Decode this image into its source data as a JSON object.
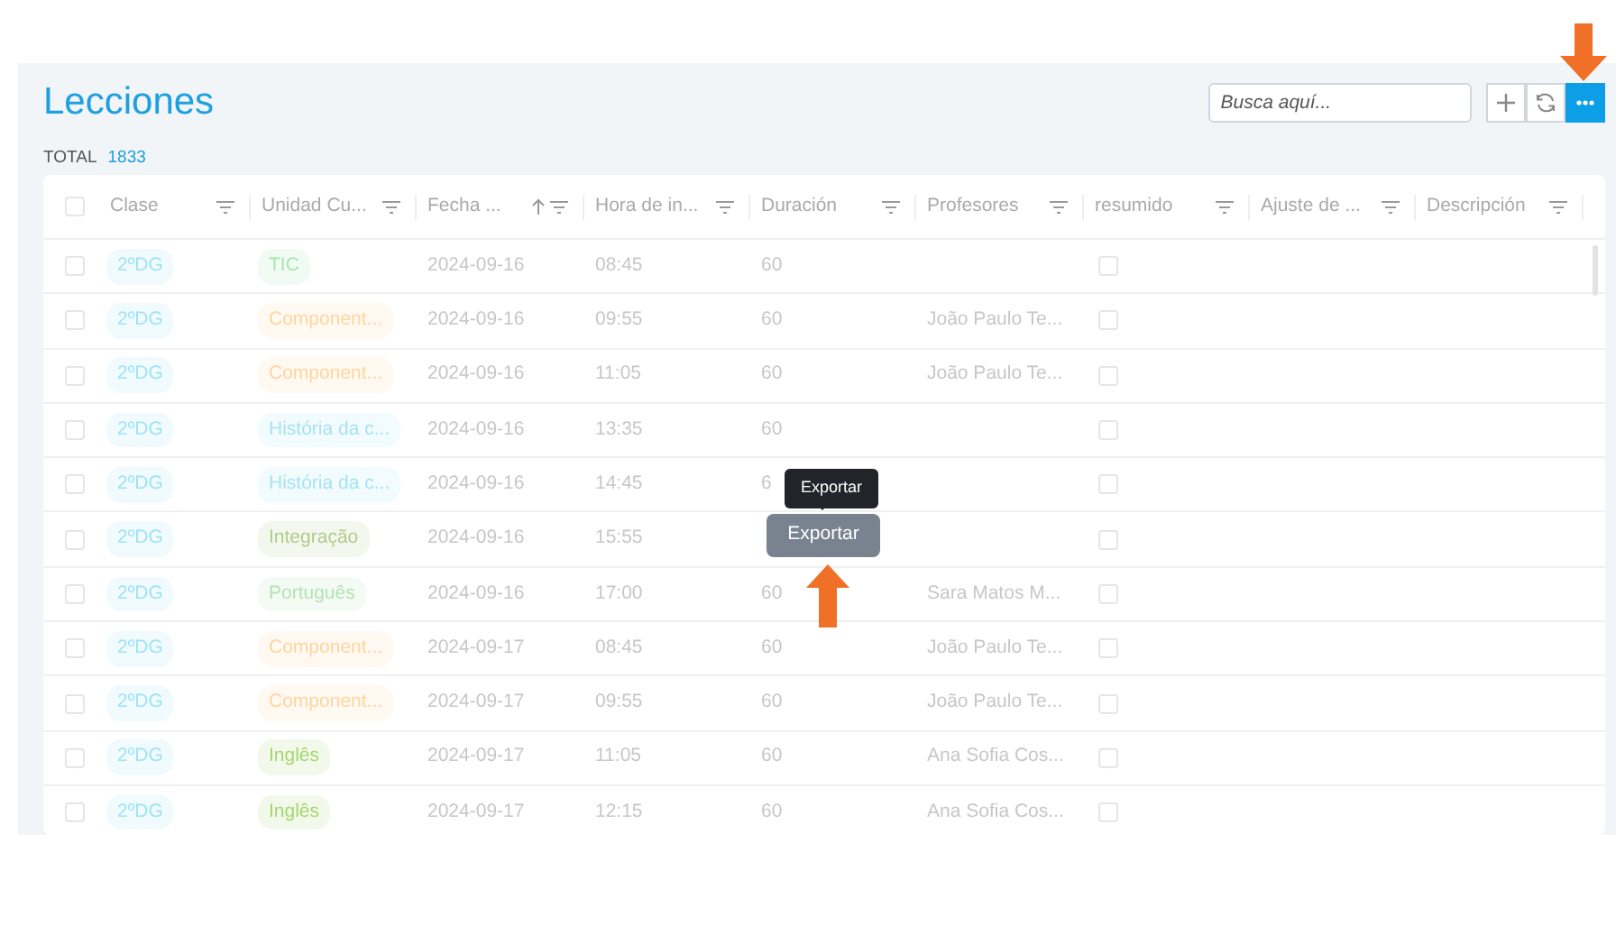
{
  "page": {
    "title": "Lecciones",
    "total_label": "TOTAL",
    "total_value": "1833"
  },
  "search": {
    "placeholder": "Busca aquí..."
  },
  "select_all": {
    "checked": false
  },
  "toolbar_buttons": [
    {
      "kind": "add"
    },
    {
      "kind": "refresh"
    },
    {
      "kind": "more",
      "selected": true
    }
  ],
  "table": {
    "columns": [
      {
        "label": "Clase",
        "sorted": false
      },
      {
        "label": "Unidad Cu...",
        "sorted": false
      },
      {
        "label": "Fecha ...",
        "sorted": true
      },
      {
        "label": "Hora de in...",
        "sorted": false
      },
      {
        "label": "Duración",
        "sorted": false
      },
      {
        "label": "Profesores",
        "sorted": false
      },
      {
        "label": "resumido",
        "sorted": false
      },
      {
        "label": "Ajuste de ...",
        "sorted": false
      },
      {
        "label": "Descripción",
        "sorted": false
      }
    ],
    "rows": [
      {
        "selected": false,
        "class": {
          "text": "2ºDG",
          "color": "#9fe3f5"
        },
        "unit": {
          "text": "TIC",
          "color": "#a6e6b0"
        },
        "date": "2024-09-16",
        "start": "08:45",
        "duration": "60",
        "summarized": false
      },
      {
        "selected": false,
        "class": {
          "text": "2ºDG",
          "color": "#9fe3f5"
        },
        "unit": {
          "text": "Component...",
          "color": "#ffd59e"
        },
        "date": "2024-09-16",
        "start": "09:55",
        "duration": "60",
        "teachers": "João Paulo Te...",
        "summarized": false
      },
      {
        "selected": false,
        "class": {
          "text": "2ºDG",
          "color": "#9fe3f5"
        },
        "unit": {
          "text": "Component...",
          "color": "#ffd59e"
        },
        "date": "2024-09-16",
        "start": "11:05",
        "duration": "60",
        "teachers": "João Paulo Te...",
        "summarized": false
      },
      {
        "selected": false,
        "class": {
          "text": "2ºDG",
          "color": "#9fe3f5"
        },
        "unit": {
          "text": "História da c...",
          "color": "#a6e3f3"
        },
        "date": "2024-09-16",
        "start": "13:35",
        "duration": "60",
        "summarized": false
      },
      {
        "selected": false,
        "class": {
          "text": "2ºDG",
          "color": "#9fe3f5"
        },
        "unit": {
          "text": "História da c...",
          "color": "#a6e3f3"
        },
        "date": "2024-09-16",
        "start": "14:45",
        "duration": "6",
        "summarized": false
      },
      {
        "selected": false,
        "class": {
          "text": "2ºDG",
          "color": "#9fe3f5"
        },
        "unit": {
          "text": "Integração",
          "color": "#b2cc8a"
        },
        "date": "2024-09-16",
        "start": "15:55",
        "summarized": false
      },
      {
        "selected": false,
        "class": {
          "text": "2ºDG",
          "color": "#9fe3f5"
        },
        "unit": {
          "text": "Português",
          "color": "#b4e4b4"
        },
        "date": "2024-09-16",
        "start": "17:00",
        "duration": "60",
        "teachers": "Sara Matos M...",
        "summarized": false
      },
      {
        "selected": false,
        "class": {
          "text": "2ºDG",
          "color": "#9fe3f5"
        },
        "unit": {
          "text": "Component...",
          "color": "#ffd59e"
        },
        "date": "2024-09-17",
        "start": "08:45",
        "duration": "60",
        "teachers": "João Paulo Te...",
        "summarized": false
      },
      {
        "selected": false,
        "class": {
          "text": "2ºDG",
          "color": "#9fe3f5"
        },
        "unit": {
          "text": "Component...",
          "color": "#ffd59e"
        },
        "date": "2024-09-17",
        "start": "09:55",
        "duration": "60",
        "teachers": "João Paulo Te...",
        "summarized": false
      },
      {
        "selected": false,
        "class": {
          "text": "2ºDG",
          "color": "#9fe3f5"
        },
        "unit": {
          "text": "Inglês",
          "color": "#a6d672"
        },
        "date": "2024-09-17",
        "start": "11:05",
        "duration": "60",
        "teachers": "Ana Sofia Cos...",
        "summarized": false
      },
      {
        "selected": false,
        "class": {
          "text": "2ºDG",
          "color": "#9fe3f5"
        },
        "unit": {
          "text": "Inglês",
          "color": "#a6d672"
        },
        "date": "2024-09-17",
        "start": "12:15",
        "duration": "60",
        "teachers": "Ana Sofia Cos...",
        "summarized": false
      }
    ]
  },
  "popup": {
    "tooltip": "Exportar",
    "button": "Exportar"
  }
}
